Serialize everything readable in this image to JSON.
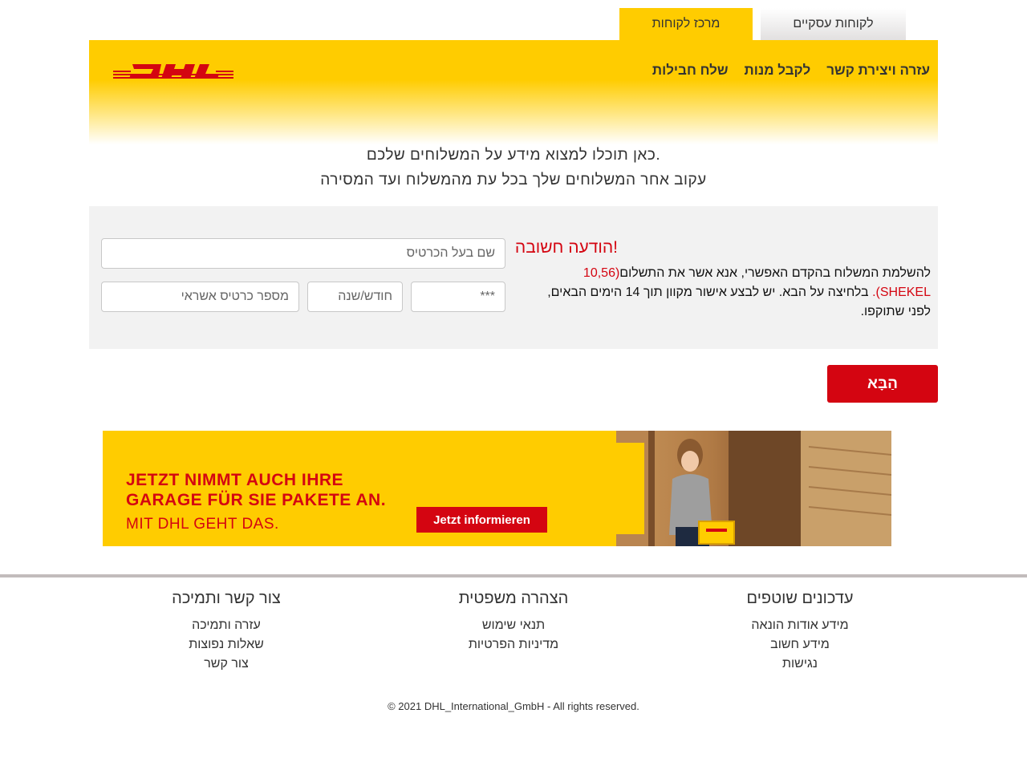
{
  "tabs": {
    "business": "לקוחות עסקיים",
    "customers": "מרכז לקוחות"
  },
  "brand": {
    "logo_text": "DHL",
    "yellow": "#ffcc00",
    "red": "#d40511"
  },
  "nav": {
    "items": [
      "עזרה ויצירת קשר",
      "לקבל מנות",
      "שלח חבילות"
    ]
  },
  "intro": {
    "line1": "כאן תוכלו למצוא מידע על המשלוחים שלכם.",
    "line2": "עקוב אחר המשלוחים שלך בכל עת מהמשלוח ועד המסירה"
  },
  "notice": {
    "title": "הודעה חשובה!",
    "text_before": "להשלמת המשלוח בהקדם האפשרי, אנא אשר את התשלום",
    "amount": "(10,56 SHEKEL).",
    "text_after": "בלחיצה על הבא. יש לבצע אישור מקוון תוך 14 הימים הבאים, לפני שתוקפו."
  },
  "form": {
    "name_placeholder": "שם בעל הכרטיס",
    "card_placeholder": "מספר כרטיס אשראי",
    "date_placeholder": "חודש/שנה",
    "cvv_placeholder": "***"
  },
  "next_button": "הַבָּא",
  "banner": {
    "line1": "JETZT NIMMT AUCH IHRE",
    "line2": "GARAGE FÜR SIE PAKETE AN.",
    "line3": "MIT DHL GEHT DAS.",
    "cta": "Jetzt informieren"
  },
  "footer": {
    "col1": {
      "title": "עדכונים שוטפים",
      "links": [
        "מידע אודות הונאה",
        "מידע חשוב",
        "נגישות"
      ]
    },
    "col2": {
      "title": "הצהרה משפטית",
      "links": [
        "תנאי שימוש",
        "מדיניות הפרטיות"
      ]
    },
    "col3": {
      "title": "צור קשר ותמיכה",
      "links": [
        "עזרה ותמיכה",
        "שאלות נפוצות",
        "צור קשר"
      ]
    },
    "copyright": "© 2021 DHL_International_GmbH - All rights reserved."
  }
}
